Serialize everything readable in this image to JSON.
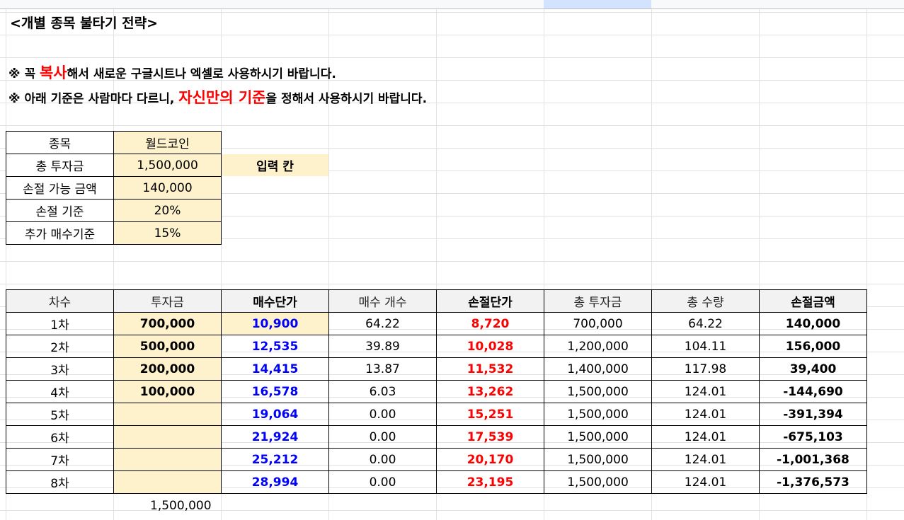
{
  "title": "<개별 종목 불타기 전략>",
  "notes": {
    "line1": {
      "prefix": "※ 꼭 ",
      "highlight": "복사",
      "suffix": "해서 새로운 구글시트나 엑셀로 사용하시기 바랍니다."
    },
    "line2": {
      "prefix": "※ 아래 기준은 사람마다 다르니, ",
      "highlight": "자신만의 기준",
      "suffix": "을 정해서 사용하시기 바랍니다."
    }
  },
  "info": [
    {
      "label": "종목",
      "value": "월드코인"
    },
    {
      "label": "총 투자금",
      "value": "1,500,000"
    },
    {
      "label": "손절 가능 금액",
      "value": "140,000"
    },
    {
      "label": "손절 기준",
      "value": "20%"
    },
    {
      "label": "추가 매수기준",
      "value": "15%"
    }
  ],
  "input_label": "입력 칸",
  "table": {
    "headers": [
      "차수",
      "투자금",
      "매수단가",
      "매수 개수",
      "손절단가",
      "총 투자금",
      "총 수량",
      "손절금액"
    ],
    "rows": [
      [
        "1차",
        "700,000",
        "10,900",
        "64.22",
        "8,720",
        "700,000",
        "64.22",
        "140,000"
      ],
      [
        "2차",
        "500,000",
        "12,535",
        "39.89",
        "10,028",
        "1,200,000",
        "104.11",
        "156,000"
      ],
      [
        "3차",
        "200,000",
        "14,415",
        "13.87",
        "11,532",
        "1,400,000",
        "117.98",
        "39,400"
      ],
      [
        "4차",
        "100,000",
        "16,578",
        "6.03",
        "13,262",
        "1,500,000",
        "124.01",
        "-144,690"
      ],
      [
        "5차",
        "",
        "19,064",
        "0.00",
        "15,251",
        "1,500,000",
        "124.01",
        "-391,394"
      ],
      [
        "6차",
        "",
        "21,924",
        "0.00",
        "17,539",
        "1,500,000",
        "124.01",
        "-675,103"
      ],
      [
        "7차",
        "",
        "25,212",
        "0.00",
        "20,170",
        "1,500,000",
        "124.01",
        "-1,001,368"
      ],
      [
        "8차",
        "",
        "28,994",
        "0.00",
        "23,195",
        "1,500,000",
        "124.01",
        "-1,376,573"
      ]
    ],
    "total": "1,500,000"
  },
  "colors": {
    "input_fill": "#fef2cc",
    "header_fill": "#f2f2f2",
    "price_blue": "#0000ff",
    "stop_red": "#ff0000"
  }
}
